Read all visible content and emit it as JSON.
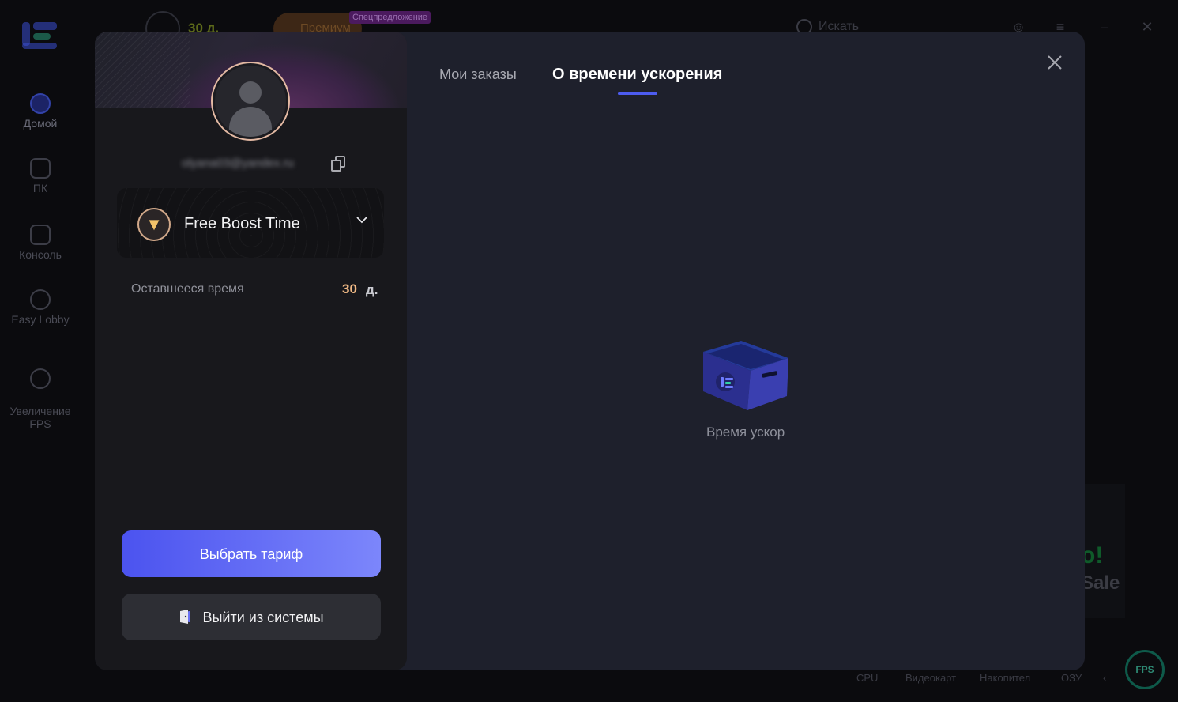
{
  "background_app": {
    "sidebar": {
      "items": [
        {
          "label": "Домой",
          "icon": "home-icon"
        },
        {
          "label": "ПК",
          "icon": "monitor-icon"
        },
        {
          "label": "Консоль",
          "icon": "gamepad-icon"
        },
        {
          "label": "Easy Lobby",
          "icon": "crosshair-icon"
        },
        {
          "label": "Увеличение\nFPS",
          "icon": "speedometer-icon"
        }
      ]
    },
    "topbar": {
      "days": "30 д.",
      "premium_label": "Премиум",
      "special_offer": "Спецпредложение",
      "search_placeholder": "Искать"
    },
    "promo": {
      "line1": "o!",
      "line2": "Sale"
    },
    "bottom_stats": [
      "CPU",
      "Видеокарт",
      "Накопител",
      "ОЗУ"
    ],
    "fps_badge": "FPS"
  },
  "profile": {
    "email": "olyana03@yandex.ru",
    "plan_name": "Free Boost Time",
    "remaining_label": "Оставшееся время",
    "remaining_value": "30",
    "remaining_unit": "д.",
    "choose_plan_label": "Выбрать тариф",
    "logout_label": "Выйти из системы"
  },
  "tabs": [
    {
      "label": "Мои заказы",
      "active": false
    },
    {
      "label": "О времени ускорения",
      "active": true
    }
  ],
  "empty_state": {
    "text": "Время ускор"
  },
  "colors": {
    "accent": "#4d5cf0",
    "remaining_value": "#f0b985",
    "modal_bg": "#1e202c",
    "panel_bg": "#18181c"
  }
}
